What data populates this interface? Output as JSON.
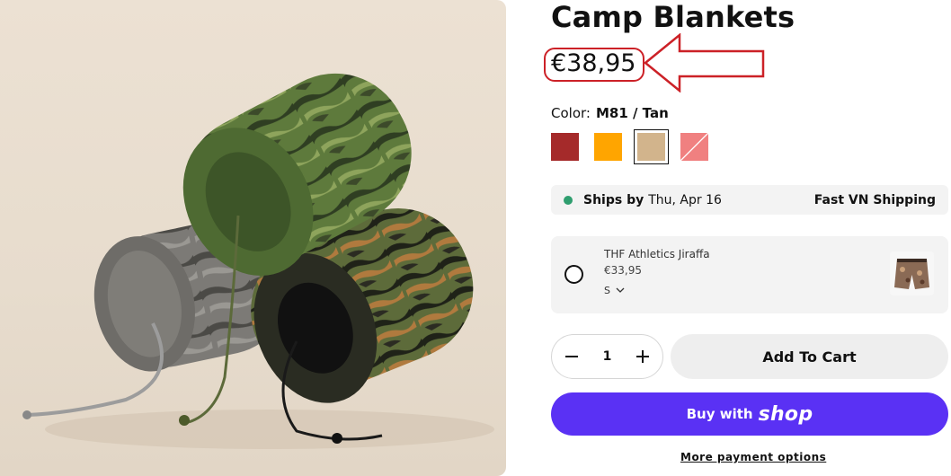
{
  "product": {
    "title": "Camp Blankets",
    "price": "€38,95",
    "color_label": "Color:",
    "color_value": "M81 / Tan"
  },
  "swatches": [
    {
      "name": "Red",
      "color": "#a52a2a"
    },
    {
      "name": "Orange",
      "color": "#ffa500"
    },
    {
      "name": "Tan",
      "color": "#d2b48c",
      "selected": true
    },
    {
      "name": "Pink",
      "color": "#f08080"
    }
  ],
  "shipping": {
    "lead": "Ships by",
    "date": "Thu, Apr 16",
    "method": "Fast VN Shipping",
    "dot_color": "#2f9e6f"
  },
  "addon": {
    "name": "THF Athletics Jiraffa",
    "price": "€33,95",
    "size": "S"
  },
  "quantity": {
    "value": "1"
  },
  "buttons": {
    "add_to_cart": "Add To Cart",
    "buy_with": "Buy with",
    "shop_brand": "shop",
    "more_payment": "More payment options"
  },
  "colors": {
    "accent_shop": "#5a31f4",
    "highlight_red": "#cc2127"
  }
}
